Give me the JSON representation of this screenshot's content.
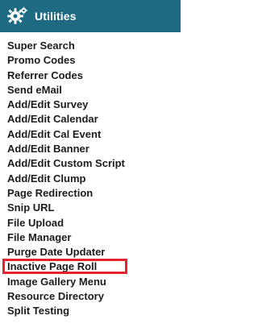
{
  "header": {
    "title": "Utilities",
    "icon": "gear-icon"
  },
  "colors": {
    "header_bg": "#1e6a82",
    "highlight_border": "#e5242d"
  },
  "menu": {
    "items": [
      {
        "label": "Super Search"
      },
      {
        "label": "Promo Codes"
      },
      {
        "label": "Referrer Codes"
      },
      {
        "label": "Send eMail"
      },
      {
        "label": "Add/Edit Survey"
      },
      {
        "label": "Add/Edit Calendar"
      },
      {
        "label": "Add/Edit Cal Event"
      },
      {
        "label": "Add/Edit Banner"
      },
      {
        "label": "Add/Edit Custom Script"
      },
      {
        "label": "Add/Edit Clump"
      },
      {
        "label": "Page Redirection"
      },
      {
        "label": "Snip URL"
      },
      {
        "label": "File Upload"
      },
      {
        "label": "File Manager"
      },
      {
        "label": "Purge Date Updater"
      },
      {
        "label": "Inactive Page Roll",
        "highlighted": true
      },
      {
        "label": "Image Gallery Menu"
      },
      {
        "label": "Resource Directory"
      },
      {
        "label": "Split Testing"
      }
    ]
  }
}
